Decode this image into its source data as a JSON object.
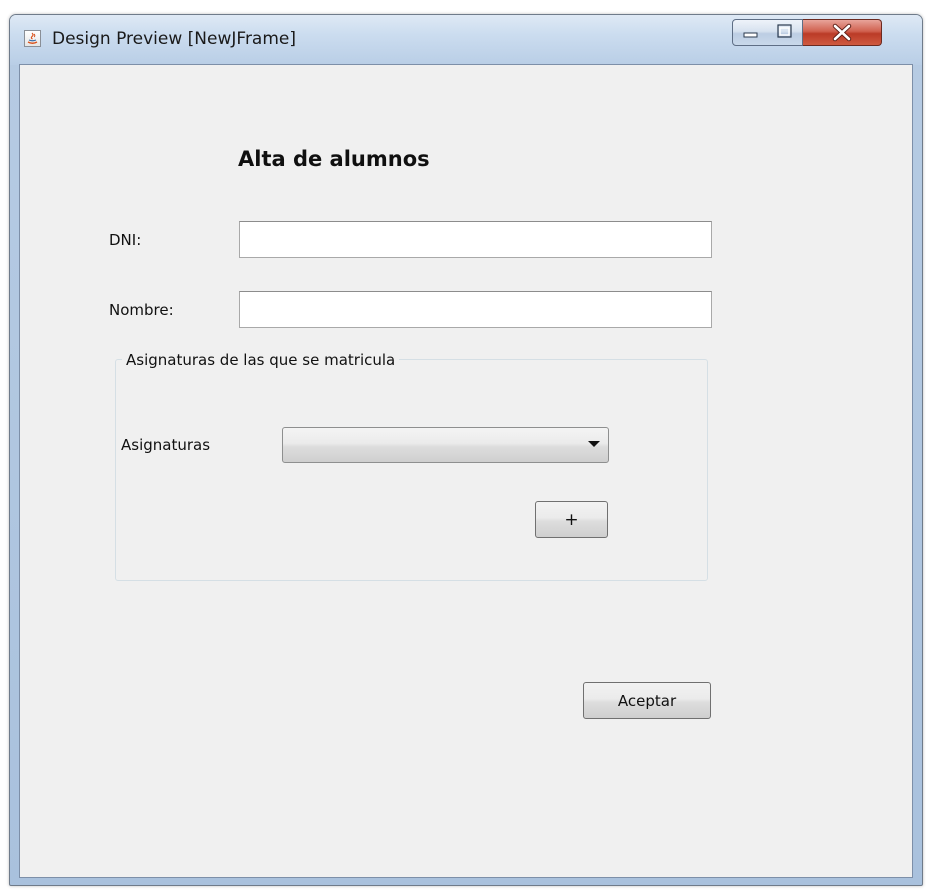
{
  "window": {
    "title": "Design Preview [NewJFrame]",
    "controls": {
      "minimize_icon": "minimize-icon",
      "maximize_icon": "maximize-icon",
      "close_icon": "close-icon"
    }
  },
  "form": {
    "heading": "Alta de alumnos",
    "dni": {
      "label": "DNI:",
      "value": ""
    },
    "nombre": {
      "label": "Nombre:",
      "value": ""
    },
    "group": {
      "title": "Asignaturas de las que se matricula",
      "asignaturas_label": "Asignaturas",
      "asignaturas_selected": "",
      "add_button_label": "+"
    },
    "accept_button_label": "Aceptar"
  },
  "colors": {
    "client_background": "#f0f0f0",
    "titlebar": "#c9dbee",
    "close_button": "#c84a36"
  }
}
